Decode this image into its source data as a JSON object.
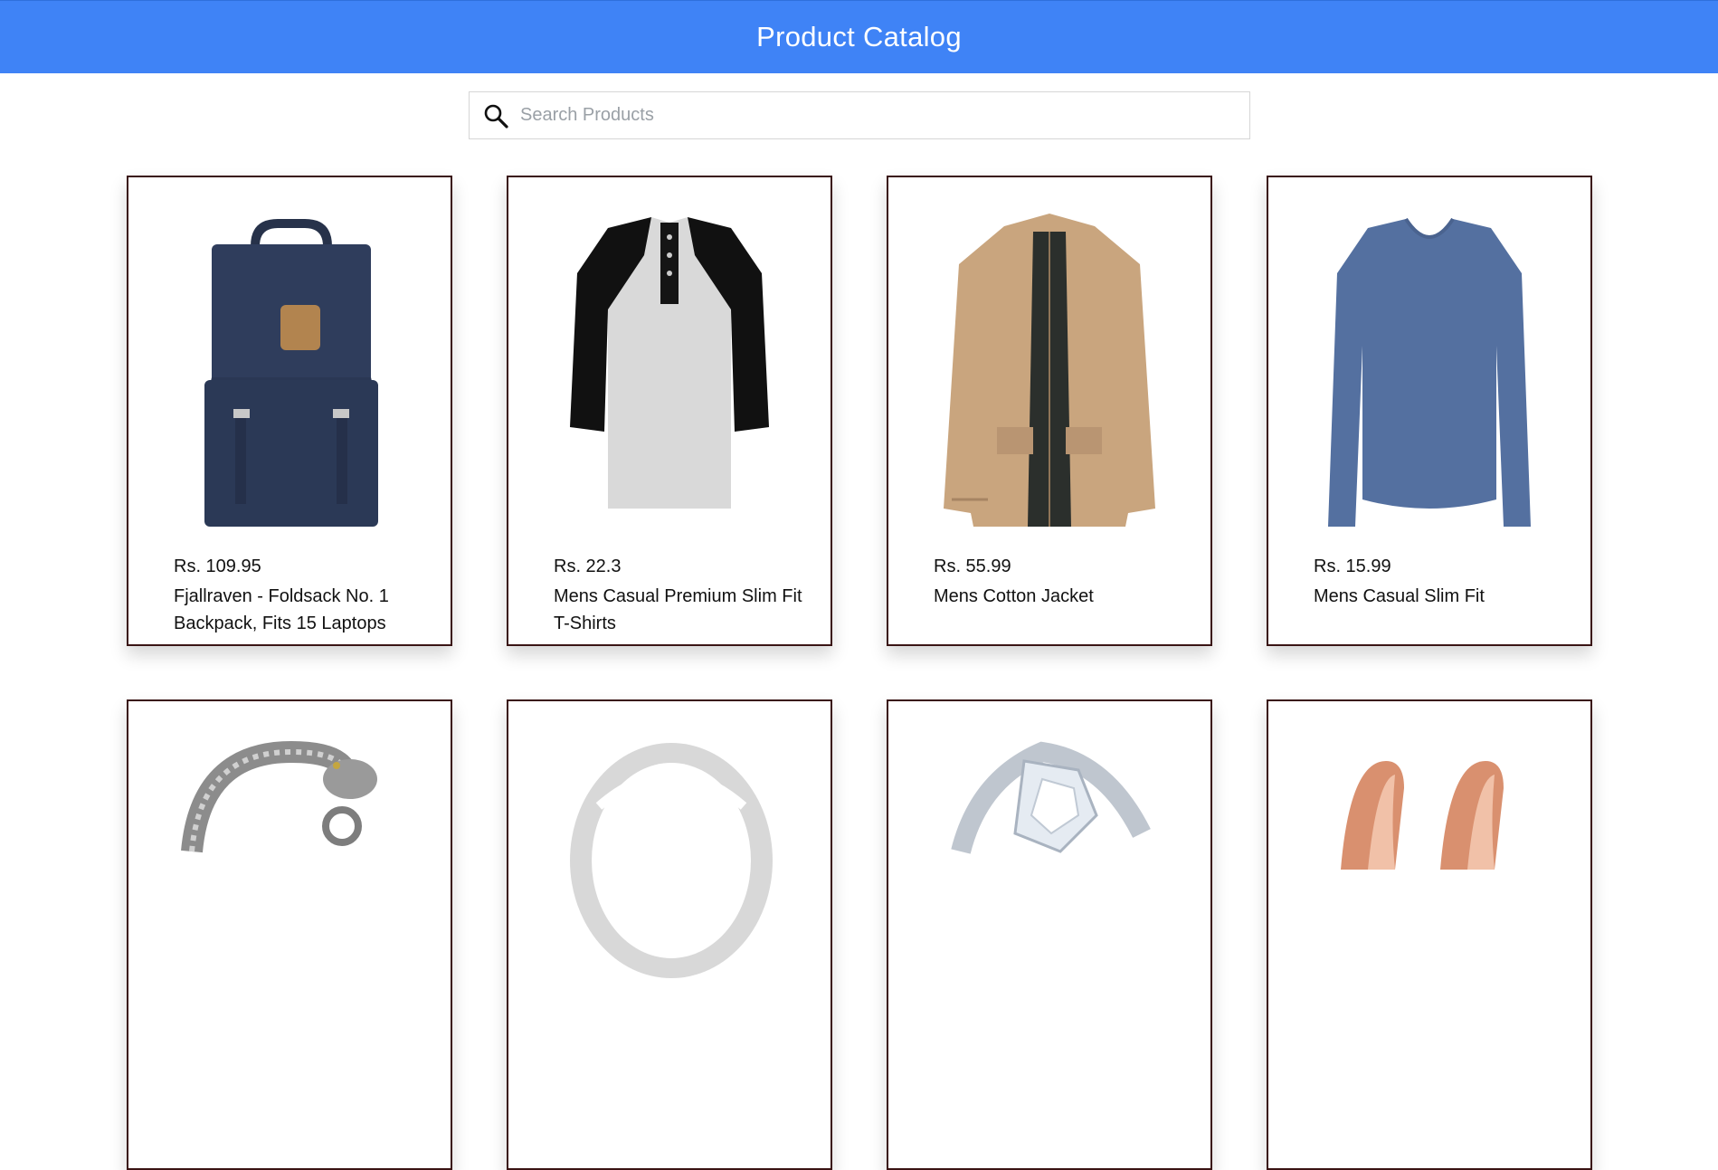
{
  "header": {
    "title": "Product Catalog",
    "bg_color": "#3f83f6"
  },
  "search": {
    "placeholder": "Search Products",
    "value": "",
    "icon": "search-icon"
  },
  "products": [
    {
      "price": "Rs. 109.95",
      "title": "Fjallraven - Foldsack No. 1 Backpack, Fits 15 Laptops",
      "image": "backpack"
    },
    {
      "price": "Rs. 22.3",
      "title": "Mens Casual Premium Slim Fit T-Shirts",
      "image": "raglan-tshirt"
    },
    {
      "price": "Rs. 55.99",
      "title": "Mens Cotton Jacket",
      "image": "cotton-jacket"
    },
    {
      "price": "Rs. 15.99",
      "title": "Mens Casual Slim Fit",
      "image": "long-sleeve-shirt"
    },
    {
      "price": "",
      "title": "",
      "image": "dragon-bracelet"
    },
    {
      "price": "",
      "title": "",
      "image": "silver-ring"
    },
    {
      "price": "",
      "title": "",
      "image": "diamond-ring"
    },
    {
      "price": "",
      "title": "",
      "image": "rose-gold-earrings"
    }
  ]
}
